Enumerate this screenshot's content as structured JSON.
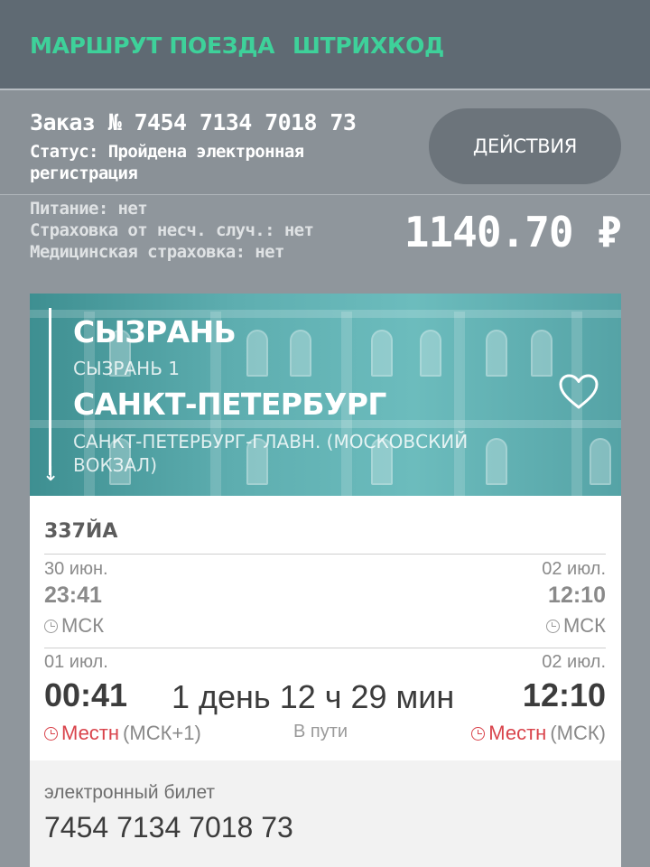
{
  "tabs": {
    "route": "МАРШРУТ ПОЕЗДА",
    "barcode": "ШТРИХКОД"
  },
  "order": {
    "number": "Заказ № 7454 7134 7018 73",
    "status": "Статус: Пройдена электронная регистрация",
    "actions_label": "ДЕЙСТВИЯ",
    "meals": "Питание: нет",
    "accident_insurance": "Страховка от несч. случ.: нет",
    "medical_insurance": "Медицинская страховка: нет",
    "price": "1140.70 ₽"
  },
  "route": {
    "from_city": "СЫЗРАНЬ",
    "from_station": "СЫЗРАНЬ 1",
    "to_city": "САНКТ-ПЕТЕРБУРГ",
    "to_station": "САНКТ-ПЕТЕРБУРГ-ГЛАВН. (МОСКОВСКИЙ ВОКЗАЛ)",
    "favorite_icon": "heart-outline-icon"
  },
  "train": {
    "number": "337ЙА",
    "moscow": {
      "dep_date": "30 июн.",
      "dep_time": "23:41",
      "dep_tz": "МСК",
      "arr_date": "02 июл.",
      "arr_time": "12:10",
      "arr_tz": "МСК"
    },
    "local": {
      "dep_date": "01 июл.",
      "dep_time": "00:41",
      "dep_tz_label": "Местн",
      "dep_tz_offset": "(МСК+1)",
      "arr_date": "02 июл.",
      "arr_time": "12:10",
      "arr_tz_label": "Местн",
      "arr_tz_offset": "(МСК)"
    },
    "duration": "1 день 12 ч 29 мин",
    "in_transit_label": "В пути"
  },
  "ticket": {
    "label": "электронный билет",
    "number": "7454 7134 7018 73"
  },
  "colors": {
    "accent": "#3ed19a",
    "local_time": "#d9434b",
    "header": "#5f6a73"
  }
}
